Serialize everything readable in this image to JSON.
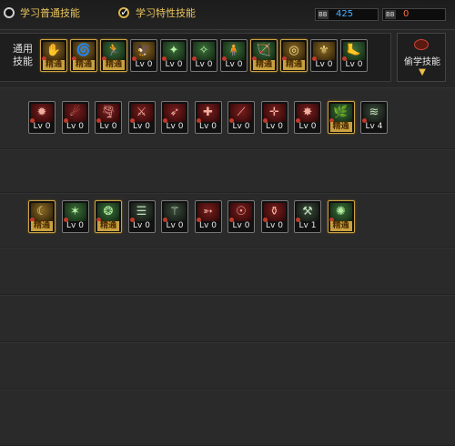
{
  "tabs": {
    "normal": "学习普通技能",
    "special": "学习特性技能"
  },
  "resources": [
    {
      "tag": "BB",
      "value": "425",
      "color": "#4ab0ff"
    },
    {
      "tag": "BB",
      "value": "0",
      "color": "#ff6a3a"
    }
  ],
  "common_label": "通用技能",
  "steal_label": "偷学技能",
  "common_skills": [
    {
      "level": "精通",
      "kind": "gold",
      "glyph": "✋"
    },
    {
      "level": "精通",
      "kind": "gold",
      "glyph": "🌀"
    },
    {
      "level": "精通",
      "kind": "green",
      "glyph": "🏃"
    },
    {
      "level": "Lv 0",
      "kind": "gold",
      "glyph": "🦅"
    },
    {
      "level": "Lv 0",
      "kind": "green",
      "glyph": "✦"
    },
    {
      "level": "Lv 0",
      "kind": "green",
      "glyph": "✧"
    },
    {
      "level": "Lv 0",
      "kind": "green",
      "glyph": "🧍"
    },
    {
      "level": "精通",
      "kind": "green",
      "glyph": "🏹"
    },
    {
      "level": "精通",
      "kind": "gold",
      "glyph": "◎"
    },
    {
      "level": "Lv 0",
      "kind": "gold",
      "glyph": "⚜"
    },
    {
      "level": "Lv 0",
      "kind": "green",
      "glyph": "🦶"
    }
  ],
  "row2_skills": [
    {
      "level": "Lv 0",
      "kind": "red",
      "glyph": "✹"
    },
    {
      "level": "Lv 0",
      "kind": "red",
      "glyph": "☄"
    },
    {
      "level": "Lv 0",
      "kind": "red",
      "glyph": "🌪"
    },
    {
      "level": "Lv 0",
      "kind": "red",
      "glyph": "⚔"
    },
    {
      "level": "Lv 0",
      "kind": "red",
      "glyph": "➶"
    },
    {
      "level": "Lv 0",
      "kind": "red",
      "glyph": "✚"
    },
    {
      "level": "Lv 0",
      "kind": "red",
      "glyph": "⟋"
    },
    {
      "level": "Lv 0",
      "kind": "red",
      "glyph": "✛"
    },
    {
      "level": "Lv 0",
      "kind": "red",
      "glyph": "✸"
    },
    {
      "level": "精通",
      "kind": "green",
      "glyph": "🌿"
    },
    {
      "level": "Lv 4",
      "kind": "dark",
      "glyph": "≋"
    }
  ],
  "row3_skills": [
    {
      "level": "精通",
      "kind": "gold",
      "glyph": "☾"
    },
    {
      "level": "Lv 0",
      "kind": "green",
      "glyph": "✶"
    },
    {
      "level": "精通",
      "kind": "green",
      "glyph": "❂"
    },
    {
      "level": "Lv 0",
      "kind": "dark",
      "glyph": "☰"
    },
    {
      "level": "Lv 0",
      "kind": "dark",
      "glyph": "⚚"
    },
    {
      "level": "Lv 0",
      "kind": "red",
      "glyph": "➳"
    },
    {
      "level": "Lv 0",
      "kind": "red",
      "glyph": "☉"
    },
    {
      "level": "Lv 0",
      "kind": "red",
      "glyph": "⚱"
    },
    {
      "level": "Lv 1",
      "kind": "dark",
      "glyph": "⚒"
    },
    {
      "level": "精通",
      "kind": "green",
      "glyph": "✺"
    }
  ]
}
